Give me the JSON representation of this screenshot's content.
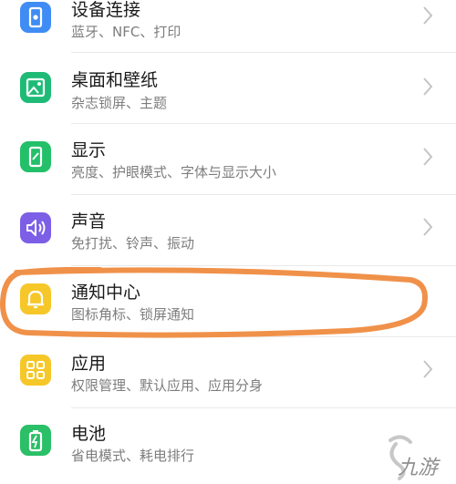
{
  "settings": {
    "items": [
      {
        "title": "设备连接",
        "subtitle": "蓝牙、NFC、打印",
        "icon": "device-connection-icon",
        "color": "#3f8cf5"
      },
      {
        "title": "桌面和壁纸",
        "subtitle": "杂志锁屏、主题",
        "icon": "wallpaper-icon",
        "color": "#1fbb76"
      },
      {
        "title": "显示",
        "subtitle": "亮度、护眼模式、字体与显示大小",
        "icon": "display-icon",
        "color": "#23c069"
      },
      {
        "title": "声音",
        "subtitle": "免打扰、铃声、振动",
        "icon": "sound-icon",
        "color": "#7c5fe6"
      },
      {
        "title": "通知中心",
        "subtitle": "图标角标、锁屏通知",
        "icon": "notification-icon",
        "color": "#f6c728"
      },
      {
        "title": "应用",
        "subtitle": "权限管理、默认应用、应用分身",
        "icon": "apps-icon",
        "color": "#f6c728"
      },
      {
        "title": "电池",
        "subtitle": "省电模式、耗电排行",
        "icon": "battery-icon",
        "color": "#2bbf67"
      }
    ]
  },
  "highlight": {
    "color": "#f0914a"
  },
  "watermark": {
    "text": "九游"
  }
}
